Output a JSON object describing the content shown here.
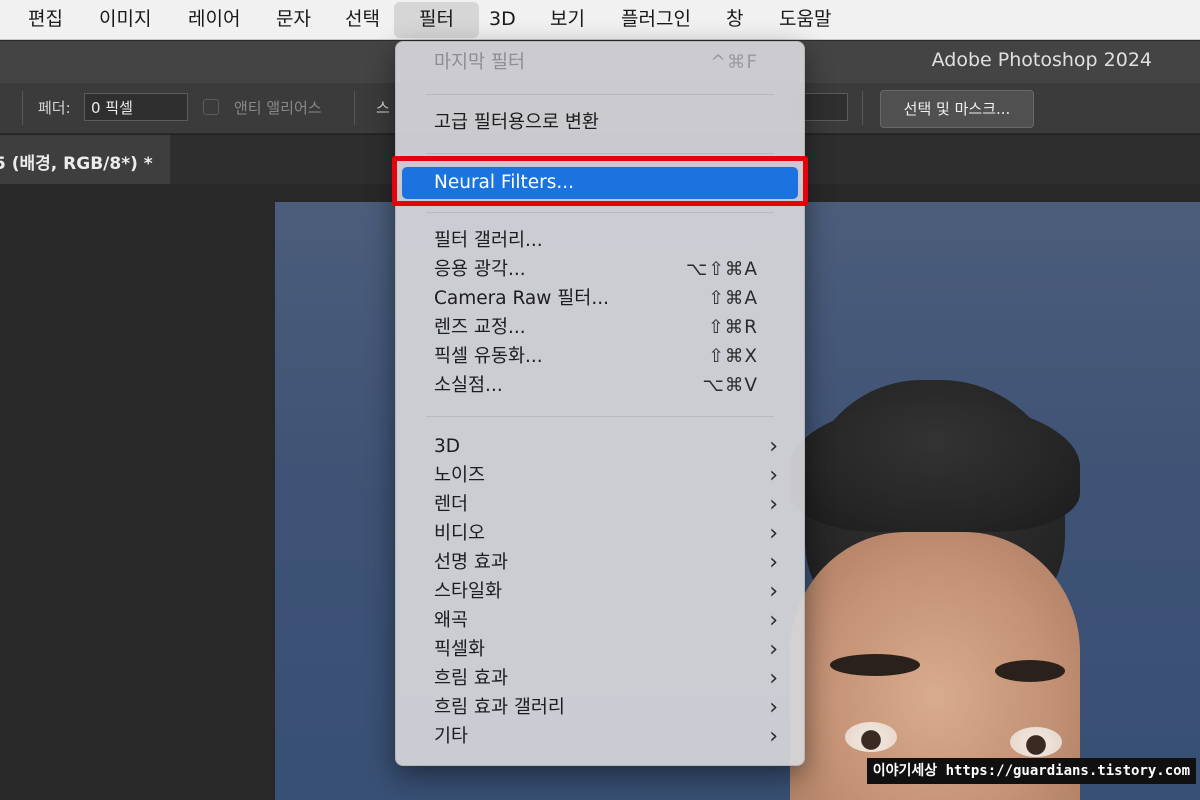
{
  "menubar": {
    "items": [
      "편집",
      "이미지",
      "레이어",
      "문자",
      "선택",
      "필터",
      "3D",
      "보기",
      "플러그인",
      "창",
      "도움말"
    ],
    "active_index": 5
  },
  "app_title": "Adobe Photoshop 2024",
  "options_bar": {
    "feather_label": "페더:",
    "feather_value": "0 픽셀",
    "antialias_label": "앤티 앨리어스",
    "style_label_partial": "스",
    "select_mask_label": "선택 및 마스크..."
  },
  "document_tab": {
    "label": "5 (배경, RGB/8*) *"
  },
  "filter_menu": {
    "last_filter": {
      "label": "마지막 필터",
      "shortcut": "^⌘F",
      "disabled": true
    },
    "convert_smart": {
      "label": "고급 필터용으로 변환"
    },
    "neural_filters": {
      "label": "Neural Filters..."
    },
    "group_items": [
      {
        "label": "필터 갤러리...",
        "shortcut": ""
      },
      {
        "label": "응용 광각...",
        "shortcut": "⌥⇧⌘A"
      },
      {
        "label": "Camera Raw 필터...",
        "shortcut": "⇧⌘A"
      },
      {
        "label": "렌즈 교정...",
        "shortcut": "⇧⌘R"
      },
      {
        "label": "픽셀 유동화...",
        "shortcut": "⇧⌘X"
      },
      {
        "label": "소실점...",
        "shortcut": "⌥⌘V"
      }
    ],
    "submenus": [
      "3D",
      "노이즈",
      "렌더",
      "비디오",
      "선명 효과",
      "스타일화",
      "왜곡",
      "픽셀화",
      "흐림 효과",
      "흐림 효과 갤러리",
      "기타"
    ],
    "submenu_icon": "chevron-right-icon"
  },
  "watermark": "이야기세상 https://guardians.tistory.com",
  "colors": {
    "highlight_blue": "#1a73de",
    "annotation_red": "#e8000b",
    "menubar_bg": "#f1f1f1"
  }
}
